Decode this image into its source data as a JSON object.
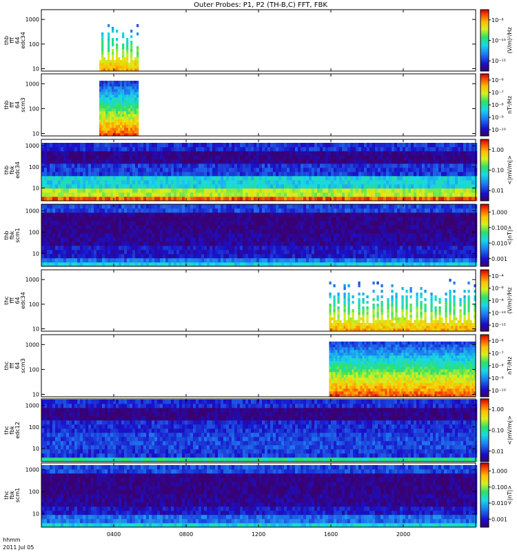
{
  "chart_data": {
    "type": "heatmap",
    "title": "Outer Probes: P1, P2 (TH-B,C) FFT, FBK",
    "footer": {
      "label": "hhmm",
      "date": "2011 Jul 05"
    },
    "x_ticks": [
      "0400",
      "0800",
      "1200",
      "1600",
      "2000"
    ],
    "x_tick_hours": [
      4,
      8,
      12,
      16,
      20
    ],
    "xlim_hours": [
      0,
      24
    ],
    "panels": [
      {
        "ylabel": [
          "thb",
          "fff",
          "64",
          "edc34"
        ],
        "yticks": [
          "10",
          "100",
          "1000"
        ],
        "ytick_values": [
          10,
          100,
          1000
        ],
        "ylim": [
          8,
          2500
        ],
        "colorbar_label": "(V/m)²/Hz",
        "colorbar_ticks": [
          "10⁻¹²",
          "10⁻¹⁰",
          "10⁻⁸"
        ],
        "data_window_hours": [
          3.2,
          5.3
        ]
      },
      {
        "ylabel": [
          "thb",
          "fff",
          "64",
          "scm3"
        ],
        "yticks": [
          "10",
          "100",
          "1000"
        ],
        "ytick_values": [
          10,
          100,
          1000
        ],
        "ylim": [
          8,
          2500
        ],
        "colorbar_label": "nT²/Hz",
        "colorbar_ticks": [
          "10⁻¹⁰",
          "10⁻⁹",
          "10⁻⁸",
          "10⁻⁷",
          "10⁻⁶"
        ],
        "data_window_hours": [
          3.2,
          5.3
        ]
      },
      {
        "ylabel": [
          "thb",
          "fbk",
          "edc34"
        ],
        "yticks": [
          "10",
          "100",
          "1000"
        ],
        "ytick_values": [
          10,
          100,
          1000
        ],
        "ylim": [
          2.5,
          2000
        ],
        "colorbar_label": "<|mV/m|>",
        "colorbar_ticks": [
          "0.01",
          "0.10",
          "1.00"
        ],
        "data_window_hours": [
          0,
          24
        ]
      },
      {
        "ylabel": [
          "thb",
          "fbk",
          "scm1"
        ],
        "yticks": [
          "10",
          "100",
          "1000"
        ],
        "ytick_values": [
          10,
          100,
          1000
        ],
        "ylim": [
          2.5,
          2000
        ],
        "colorbar_label": "<|nT|>",
        "colorbar_ticks": [
          "0.001",
          "0.010",
          "0.100",
          "1.000"
        ],
        "data_window_hours": [
          0,
          24
        ]
      },
      {
        "ylabel": [
          "thc",
          "fff",
          "64",
          "edc34"
        ],
        "yticks": [
          "10",
          "100",
          "1000"
        ],
        "ytick_values": [
          10,
          100,
          1000
        ],
        "ylim": [
          8,
          2500
        ],
        "colorbar_label": "(V/m)²/Hz",
        "colorbar_ticks": [
          "10⁻¹²",
          "10⁻¹⁰",
          "10⁻⁸",
          "10⁻⁶",
          "10⁻⁴"
        ],
        "data_window_hours": [
          15.9,
          24
        ]
      },
      {
        "ylabel": [
          "thc",
          "fff",
          "64",
          "scm3"
        ],
        "yticks": [
          "10",
          "100",
          "1000"
        ],
        "ytick_values": [
          10,
          100,
          1000
        ],
        "ylim": [
          8,
          2500
        ],
        "colorbar_label": "nT²/Hz",
        "colorbar_ticks": [
          "10⁻¹⁰",
          "10⁻⁹",
          "10⁻⁸",
          "10⁻⁷",
          "10⁻⁶"
        ],
        "data_window_hours": [
          15.9,
          24
        ]
      },
      {
        "ylabel": [
          "thc",
          "fbk",
          "edc12"
        ],
        "yticks": [
          "10",
          "100",
          "1000"
        ],
        "ytick_values": [
          10,
          100,
          1000
        ],
        "ylim": [
          2.5,
          2000
        ],
        "colorbar_label": "<|mV/m|>",
        "colorbar_ticks": [
          "0.01",
          "0.10",
          "1.00"
        ],
        "data_window_hours": [
          0,
          24
        ]
      },
      {
        "ylabel": [
          "thc",
          "fbk",
          "scm1"
        ],
        "yticks": [
          "10",
          "100",
          "1000"
        ],
        "ytick_values": [
          10,
          100,
          1000
        ],
        "ylim": [
          2.5,
          2000
        ],
        "colorbar_label": "<|nT|>",
        "colorbar_ticks": [
          "0.001",
          "0.010",
          "0.100",
          "1.000"
        ],
        "data_window_hours": [
          0,
          24
        ]
      }
    ]
  }
}
